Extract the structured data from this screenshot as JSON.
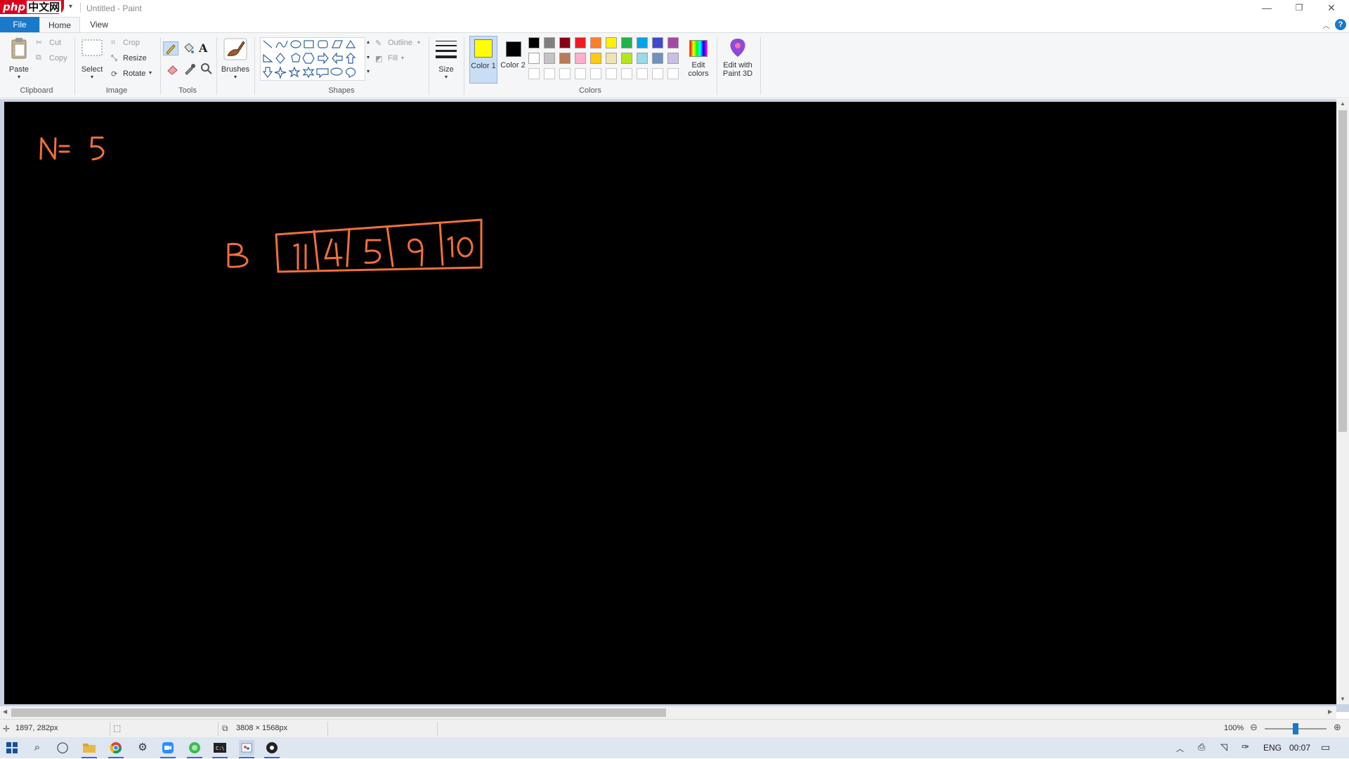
{
  "window": {
    "logo_text": "php",
    "logo_cn": "中文网",
    "title": "Untitled - Paint",
    "minimize": "—",
    "restore": "❐",
    "close": "✕"
  },
  "tabs": {
    "file": "File",
    "home": "Home",
    "view": "View"
  },
  "ribbon": {
    "clipboard": {
      "paste": "Paste",
      "cut": "Cut",
      "copy": "Copy",
      "label": "Clipboard"
    },
    "image": {
      "select": "Select",
      "crop": "Crop",
      "resize": "Resize",
      "rotate": "Rotate",
      "label": "Image"
    },
    "tools": {
      "label": "Tools"
    },
    "brushes": {
      "label": "Brushes"
    },
    "shapes": {
      "outline": "Outline",
      "fill": "Fill",
      "label": "Shapes"
    },
    "size": {
      "label": "Size"
    },
    "colors": {
      "color1_label": "Color 1",
      "color2_label": "Color 2",
      "edit_colors": "Edit colors",
      "label": "Colors",
      "color1": "#ffff00",
      "color2": "#000000",
      "palette_row1": [
        "#000000",
        "#7f7f7f",
        "#880015",
        "#ed1c24",
        "#ff7f27",
        "#fff200",
        "#22b14c",
        "#00a2e8",
        "#3f48cc",
        "#a349a4"
      ],
      "palette_row2": [
        "#ffffff",
        "#c3c3c3",
        "#b97a57",
        "#ffaec9",
        "#ffc90e",
        "#efe4b0",
        "#b5e61d",
        "#99d9ea",
        "#7092be",
        "#c8bfe7"
      ]
    },
    "paint3d": {
      "label": "Edit with Paint 3D"
    }
  },
  "drawing": {
    "stroke_color": "#f0703a",
    "n_text": "N=5",
    "array_name": "B",
    "cells": [
      "1",
      "4",
      "5",
      "9",
      "10"
    ]
  },
  "status": {
    "cursor_pos": "1897, 282px",
    "canvas_size": "3808 × 1568px",
    "zoom": "100%",
    "zoom_fraction": 0.5
  },
  "taskbar": {
    "lang": "ENG",
    "time": "00:07"
  }
}
